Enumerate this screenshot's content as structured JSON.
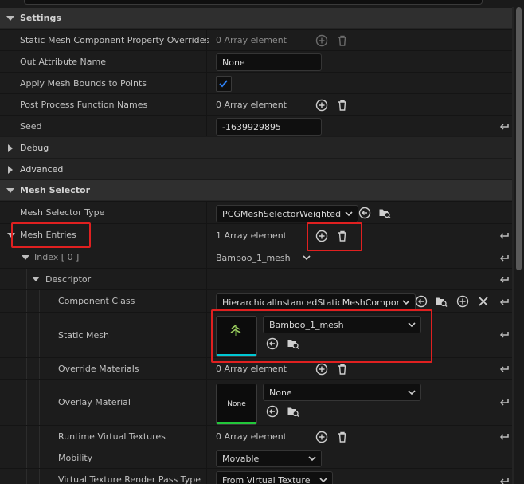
{
  "sections": {
    "settings": "Settings",
    "debug": "Debug",
    "advanced": "Advanced",
    "mesh_selector": "Mesh Selector"
  },
  "rows": {
    "static_overrides": {
      "label": "Static Mesh Component Property Overrides",
      "value": "0 Array element"
    },
    "out_attr": {
      "label": "Out Attribute Name",
      "value": "None"
    },
    "apply_bounds": {
      "label": "Apply Mesh Bounds to Points"
    },
    "post_process": {
      "label": "Post Process Function Names",
      "value": "0 Array element"
    },
    "seed": {
      "label": "Seed",
      "value": "-1639929895"
    },
    "mesh_selector_type": {
      "label": "Mesh Selector Type",
      "value": "PCGMeshSelectorWeighted"
    },
    "mesh_entries": {
      "label": "Mesh Entries",
      "value": "1 Array element"
    },
    "index0": {
      "label": "Index [ 0 ]",
      "value": "Bamboo_1_mesh"
    },
    "descriptor": {
      "label": "Descriptor"
    },
    "component_class": {
      "label": "Component Class",
      "value": "HierarchicalInstancedStaticMeshCompor"
    },
    "static_mesh": {
      "label": "Static Mesh",
      "value": "Bamboo_1_mesh"
    },
    "override_materials": {
      "label": "Override Materials",
      "value": "0 Array element"
    },
    "overlay_material": {
      "label": "Overlay Material",
      "value": "None",
      "thumb": "None"
    },
    "runtime_vt": {
      "label": "Runtime Virtual Textures",
      "value": "0 Array element"
    },
    "mobility": {
      "label": "Mobility",
      "value": "Movable"
    },
    "vt_render_pass": {
      "label": "Virtual Texture Render Pass Type",
      "value": "From Virtual Texture"
    }
  },
  "colors": {
    "highlight": "#e02020",
    "checkbox_accent": "#2e7ff0",
    "mesh_thumb_bar": "#00c8d4",
    "material_thumb_bar": "#22c83a"
  }
}
